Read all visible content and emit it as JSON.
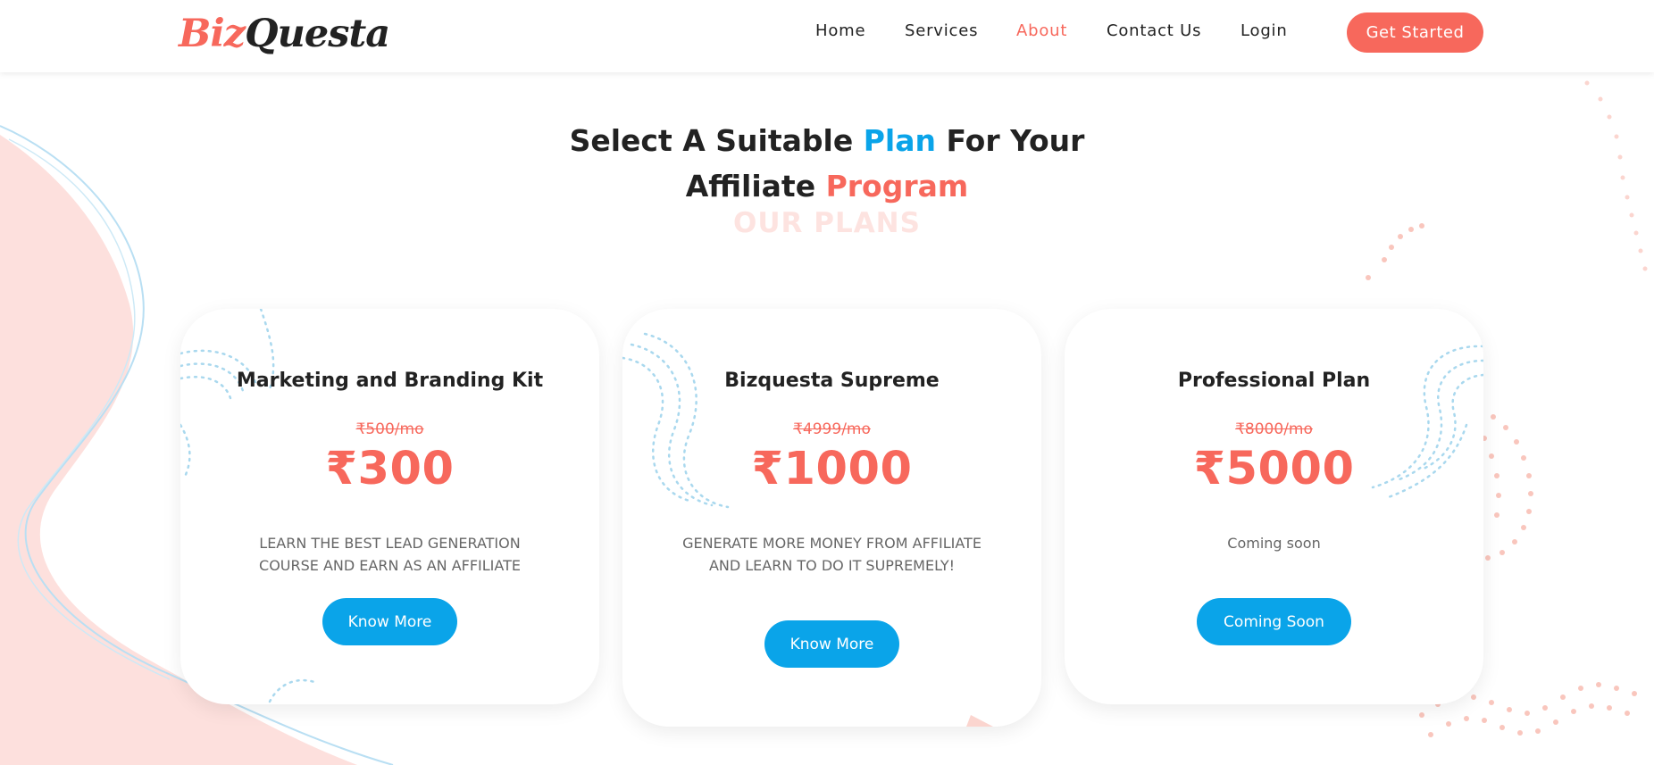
{
  "brand": {
    "part1": "Biz",
    "part2": "Questa"
  },
  "nav": {
    "home": "Home",
    "services": "Services",
    "about": "About",
    "contact": "Contact Us",
    "login": "Login",
    "cta": "Get Started"
  },
  "colors": {
    "accent": "#f7685c",
    "blue": "#0aa4e9",
    "text": "#222222"
  },
  "heading": {
    "line1_pre": "Select A Suitable ",
    "line1_blue": "Plan",
    "line1_post": " For Your",
    "line2_pre": "Affiliate ",
    "line2_coral": "Program",
    "background_text": "OUR PLANS"
  },
  "plans": [
    {
      "title": "Marketing and Branding Kit",
      "old_price": "₹500/mo",
      "price": "₹300",
      "desc_line1": "LEARN THE BEST LEAD GENERATION",
      "desc_line2": "COURSE AND EARN AS AN AFFILIATE",
      "button": "Know More"
    },
    {
      "title": "Bizquesta Supreme",
      "old_price": "₹4999/mo",
      "price": "₹1000",
      "desc_line1": "GENERATE MORE MONEY FROM AFFILIATE",
      "desc_line2": "AND LEARN TO DO IT SUPREMELY!",
      "button": "Know More"
    },
    {
      "title": "Professional Plan",
      "old_price": "₹8000/mo",
      "price": "₹5000",
      "desc_line1": "Coming soon",
      "desc_line2": "",
      "button": "Coming Soon"
    }
  ]
}
